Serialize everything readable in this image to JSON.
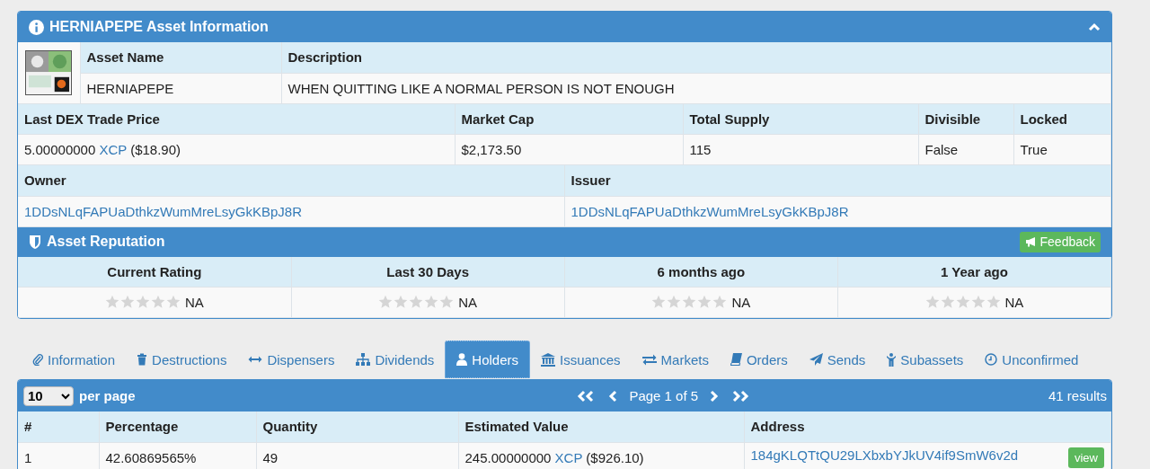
{
  "asset_info": {
    "title": "HERNIAPEPE Asset Information",
    "name_columns": [
      "Asset Name",
      "Description"
    ],
    "name_values": [
      "HERNIAPEPE",
      "WHEN QUITTING LIKE A NORMAL PERSON IS NOT ENOUGH"
    ],
    "market_columns": [
      "Last DEX Trade Price",
      "Market Cap",
      "Total Supply",
      "Divisible",
      "Locked"
    ],
    "market_values": [
      {
        "text": "5.00000000",
        "link": "XCP",
        "after": "($18.90)"
      },
      {
        "text": "$2,173.50"
      },
      {
        "text": "115"
      },
      {
        "text": "False"
      },
      {
        "text": "True"
      }
    ],
    "owner_columns": [
      "Owner",
      "Issuer"
    ],
    "owner_values": [
      "1DDsNLqFAPUaDthkzWumMreLsyGkKBpJ8R",
      "1DDsNLqFAPUaDthkzWumMreLsyGkKBpJ8R"
    ]
  },
  "reputation": {
    "title": "Asset Reputation",
    "feedback_button": "Feedback",
    "ratings": [
      {
        "label": "Current Rating",
        "stars": 0,
        "value": "NA"
      },
      {
        "label": "Last 30 Days",
        "stars": 0,
        "value": "NA"
      },
      {
        "label": "6 months ago",
        "stars": 0,
        "value": "NA"
      },
      {
        "label": "1 Year ago",
        "stars": 0,
        "value": "NA"
      }
    ]
  },
  "tabs": [
    {
      "label": "Information",
      "selected": false
    },
    {
      "label": "Destructions",
      "selected": false
    },
    {
      "label": "Dispensers",
      "selected": false
    },
    {
      "label": "Dividends",
      "selected": false
    },
    {
      "label": "Holders",
      "selected": true
    },
    {
      "label": "Issuances",
      "selected": false
    },
    {
      "label": "Markets",
      "selected": false
    },
    {
      "label": "Orders",
      "selected": false
    },
    {
      "label": "Sends",
      "selected": false
    },
    {
      "label": "Subassets",
      "selected": false
    },
    {
      "label": "Unconfirmed",
      "selected": false
    }
  ],
  "holders": {
    "per_page": "10",
    "per_page_label": "per page",
    "pager": "Page 1 of 5",
    "results": "41 results",
    "columns": [
      "#",
      "Percentage",
      "Quantity",
      "Estimated Value",
      "Address"
    ],
    "rows": [
      {
        "number": "1",
        "percentage": "42.60869565%",
        "quantity": "49",
        "value": {
          "text": "245.00000000",
          "link": "XCP",
          "after": "($926.10)"
        },
        "address": "184gKLQTtQU29LXbxbYJkUV4if9SmW6v2d",
        "button": "view"
      }
    ]
  }
}
